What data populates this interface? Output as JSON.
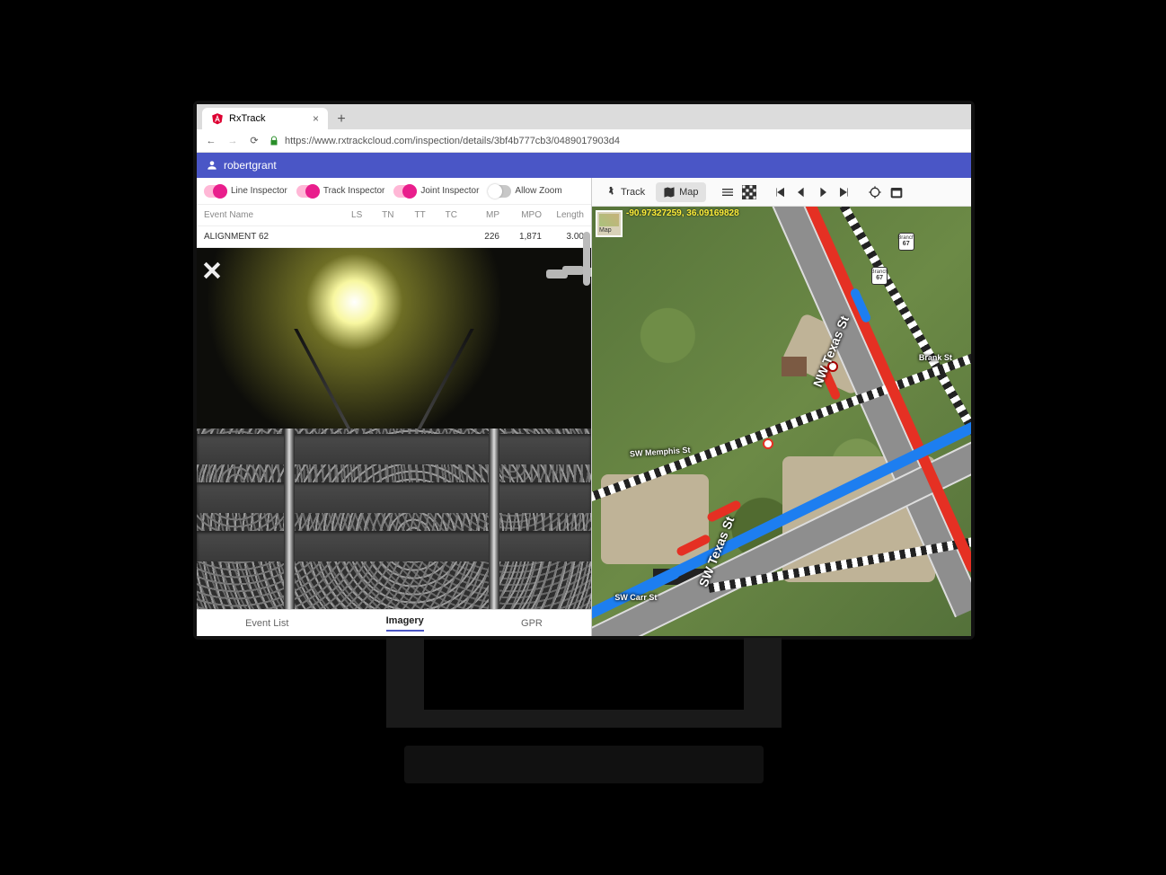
{
  "browser": {
    "tab_title": "RxTrack",
    "url": "https://www.rxtrackcloud.com/inspection/details/3bf4b777cb3/0489017903d4"
  },
  "user": {
    "name": "robertgrant"
  },
  "left_toolbar": {
    "line_inspector": "Line Inspector",
    "track_inspector": "Track Inspector",
    "joint_inspector": "Joint Inspector",
    "allow_zoom": "Allow Zoom"
  },
  "table": {
    "headers": {
      "event_name": "Event Name",
      "ls": "LS",
      "tn": "TN",
      "tt": "TT",
      "tc": "TC",
      "mp": "MP",
      "mpo": "MPO",
      "length": "Length"
    },
    "rows": [
      {
        "event_name": "ALIGNMENT 62",
        "ls": "",
        "tn": "",
        "tt": "",
        "tc": "",
        "mp": "226",
        "mpo": "1,871",
        "length": "3.00"
      }
    ]
  },
  "bottom_tabs": {
    "event_list": "Event List",
    "imagery": "Imagery",
    "gpr": "GPR"
  },
  "right_toolbar": {
    "track": "Track",
    "map": "Map"
  },
  "map": {
    "coords": "-90.97327259, 36.09169828",
    "type_label": "Map",
    "streets": {
      "nw": "NW Texas St",
      "sw": "SW Texas St",
      "memphis": "SW Memphis St",
      "brank": "Brank St",
      "carr": "SW Carr St"
    },
    "shield": {
      "top": "Branch",
      "num": "67"
    }
  }
}
